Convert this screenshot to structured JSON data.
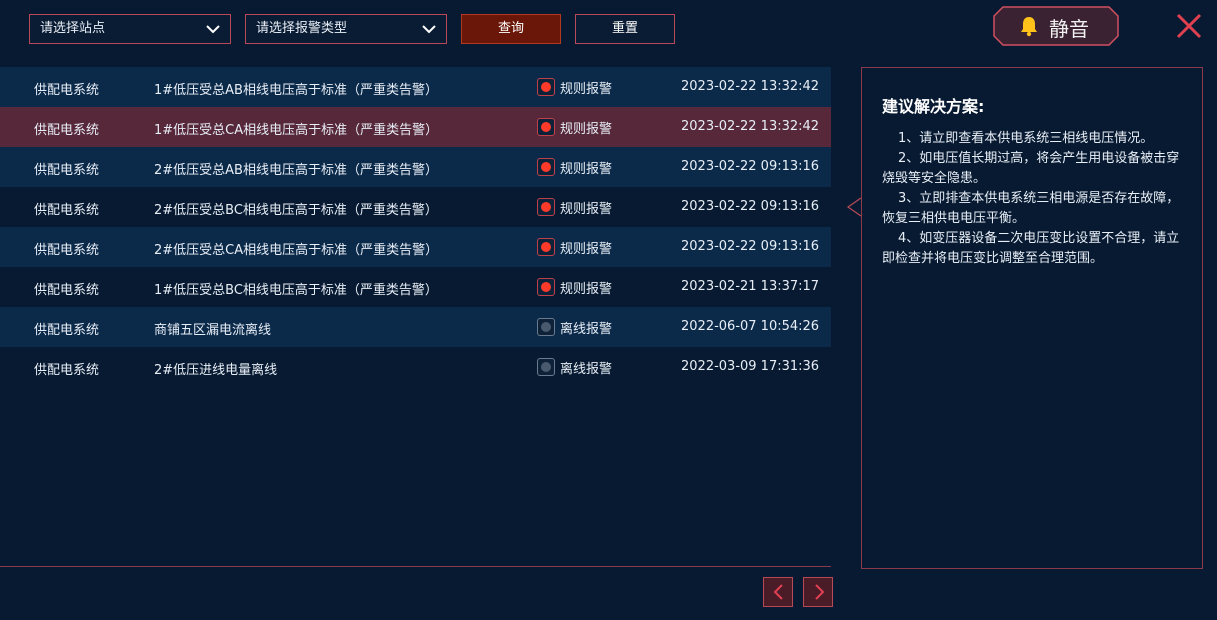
{
  "filters": {
    "site_placeholder": "请选择站点",
    "type_placeholder": "请选择报警类型",
    "query_label": "查询",
    "reset_label": "重置"
  },
  "mute": {
    "label": "静音",
    "icon": "bell-icon"
  },
  "close": {
    "icon": "close-icon"
  },
  "alarms": [
    {
      "system": "供配电系统",
      "description": "1#低压受总AB相线电压高于标准（严重类告警）",
      "type": "规则报警",
      "time": "2023-02-22 13:32:42",
      "status_color": "#ff3a2a"
    },
    {
      "system": "供配电系统",
      "description": "1#低压受总CA相线电压高于标准（严重类告警）",
      "type": "规则报警",
      "time": "2023-02-22 13:32:42",
      "status_color": "#ff3a2a"
    },
    {
      "system": "供配电系统",
      "description": "2#低压受总AB相线电压高于标准（严重类告警）",
      "type": "规则报警",
      "time": "2023-02-22 09:13:16",
      "status_color": "#ff3a2a"
    },
    {
      "system": "供配电系统",
      "description": "2#低压受总BC相线电压高于标准（严重类告警）",
      "type": "规则报警",
      "time": "2023-02-22 09:13:16",
      "status_color": "#ff3a2a"
    },
    {
      "system": "供配电系统",
      "description": "2#低压受总CA相线电压高于标准（严重类告警）",
      "type": "规则报警",
      "time": "2023-02-22 09:13:16",
      "status_color": "#ff3a2a"
    },
    {
      "system": "供配电系统",
      "description": "1#低压受总BC相线电压高于标准（严重类告警）",
      "type": "规则报警",
      "time": "2023-02-21 13:37:17",
      "status_color": "#ff3a2a"
    },
    {
      "system": "供配电系统",
      "description": "商铺五区漏电流离线",
      "type": "离线报警",
      "time": "2022-06-07 10:54:26",
      "status_color": "#4a5a6e"
    },
    {
      "system": "供配电系统",
      "description": "2#低压进线电量离线",
      "type": "离线报警",
      "time": "2022-03-09 17:31:36",
      "status_color": "#4a5a6e"
    }
  ],
  "selected_row": 1,
  "solution": {
    "title": "建议解决方案:",
    "items": [
      "1、请立即查看本供电系统三相线电压情况。",
      "2、如电压值长期过高，将会产生用电设备被击穿烧毁等安全隐患。",
      "3、立即排查本供电系统三相电源是否存在故障，恢复三相供电电压平衡。",
      "4、如变压器设备二次电压变比设置不合理，请立即检查并将电压变比调整至合理范围。"
    ]
  },
  "pagination": {
    "prev_icon": "chevron-left-icon",
    "next_icon": "chevron-right-icon"
  },
  "colors": {
    "background": "#071a31",
    "row_alt": "#0b2a4a",
    "row_selected": "#56283a",
    "accent_border": "#b84a58",
    "alarm_red": "#ff3a2a",
    "offline_gray": "#4a5a6e"
  }
}
